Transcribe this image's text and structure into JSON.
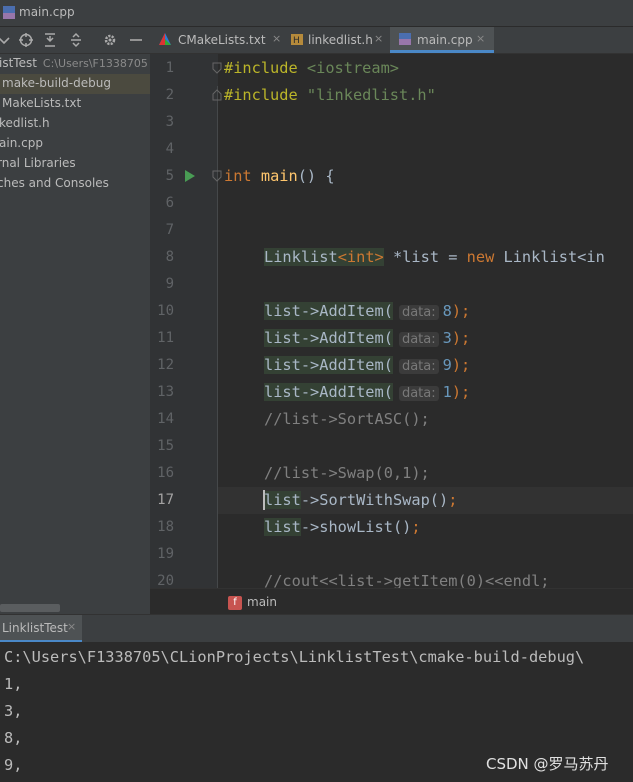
{
  "window": {
    "title": "main.cpp"
  },
  "toolbar": {
    "icons": [
      "target-icon",
      "collapse-all-icon",
      "expand-all-icon",
      "gear-icon",
      "minimize-icon"
    ]
  },
  "tabs": [
    {
      "label": "CMakeLists.txt",
      "icon": "cmake-icon",
      "close": "×"
    },
    {
      "label": "linkedlist.h",
      "icon": "header-file-icon",
      "close": "×"
    },
    {
      "label": "main.cpp",
      "icon": "cpp-file-icon",
      "close": "×",
      "active": true
    }
  ],
  "project": {
    "root_label": "istTest",
    "root_path": "C:\\Users\\F1338705",
    "items": [
      "make-build-debug",
      "MakeLists.txt",
      "kedlist.h",
      "ain.cpp",
      "rnal Libraries",
      "ches and Consoles"
    ]
  },
  "editor": {
    "line_numbers": [
      "1",
      "2",
      "3",
      "4",
      "5",
      "6",
      "7",
      "8",
      "9",
      "10",
      "11",
      "12",
      "13",
      "14",
      "15",
      "16",
      "17",
      "18",
      "19",
      "20"
    ],
    "current_line": "17",
    "inlay_hint": "data:",
    "code": {
      "l1_kw": "#include",
      "l1_lib": "<iostream>",
      "l2_kw": "#include",
      "l2_str": "\"linkedlist.h\"",
      "l5_type": "int",
      "l5_fn": "main",
      "l5_rest": "() {",
      "l8_a": "Linklist",
      "l8_b": "<",
      "l8_c": "int",
      "l8_d": ">",
      "l8_e": " *list = ",
      "l8_f": "new",
      "l8_g": " Linklist<in",
      "l10_call": "list->AddItem(",
      "l10_val": "8",
      "l10_end": ");",
      "l11_call": "list->AddItem(",
      "l11_val": "3",
      "l11_end": ");",
      "l12_call": "list->AddItem(",
      "l12_val": "9",
      "l12_end": ");",
      "l13_call": "list->AddItem(",
      "l13_val": "1",
      "l13_end": ");",
      "l14": "//list->SortASC();",
      "l16": "//list->Swap(0,1);",
      "l17_var": "list",
      "l17_rest": "->SortWithSwap()",
      "l17_end": ";",
      "l18_var": "list",
      "l18_rest": "->showList()",
      "l18_end": ";",
      "l20": "//cout<<list->getItem(0)<<endl;"
    }
  },
  "breadcrumb": {
    "badge": "f",
    "label": "main"
  },
  "run": {
    "tab_label": "LinklistTest",
    "close": "×"
  },
  "console": {
    "lines": [
      "C:\\Users\\F1338705\\CLionProjects\\LinklistTest\\cmake-build-debug\\",
      "1,",
      "3,",
      "8,",
      "9,"
    ]
  },
  "watermark": "CSDN @罗马苏丹",
  "colors": {
    "accent": "#4a88c7",
    "keyword": "#cc7832",
    "string": "#6a8759",
    "number": "#6897bb",
    "function": "#ffc66d",
    "comment": "#808080"
  }
}
